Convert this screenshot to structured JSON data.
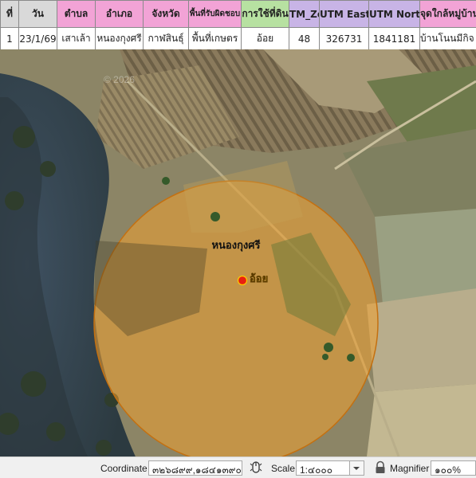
{
  "table": {
    "headers": [
      "ที่",
      "วัน",
      "ตำบล",
      "อำเภอ",
      "จังหวัด",
      "พื้นที่รับผิดชอบ",
      "การใช้ที่ดิน",
      "TM_Zo",
      "UTM East",
      "UTM North",
      "จุดใกล้หมู่บ้าน"
    ],
    "header_colors": [
      "#d9d9d9",
      "#d9d9d9",
      "#f2a3d6",
      "#f2a3d6",
      "#f2a3d6",
      "#f2a3d6",
      "#b7e1a1",
      "#c8b4e6",
      "#c8b4e6",
      "#c8b4e6",
      "#f2a3d6"
    ],
    "row": [
      "1",
      "23/1/69",
      "เสาเล้า",
      "หนองกุงศรี",
      "กาฬสินธุ์",
      "พื้นที่เกษตร",
      "อ้อย",
      "48",
      "326731",
      "1841181",
      "บ้านโนนมีกิจ"
    ]
  },
  "map": {
    "watermark": "© 2026",
    "buffer_fill_color": "#f0a030",
    "point": {
      "label": "อ้อย",
      "color": "#e82010"
    },
    "place_label": "หนองกุงศรี"
  },
  "statusbar": {
    "coordinate_label": "Coordinate",
    "coordinate_value": "๓๒๖๘๙๙,๑๘๔๑๓๙๐",
    "scale_label": "Scale",
    "scale_value": "1:๔๐๐๐",
    "magnifier_label": "Magnifier",
    "magnifier_value": "๑๐๐%"
  }
}
